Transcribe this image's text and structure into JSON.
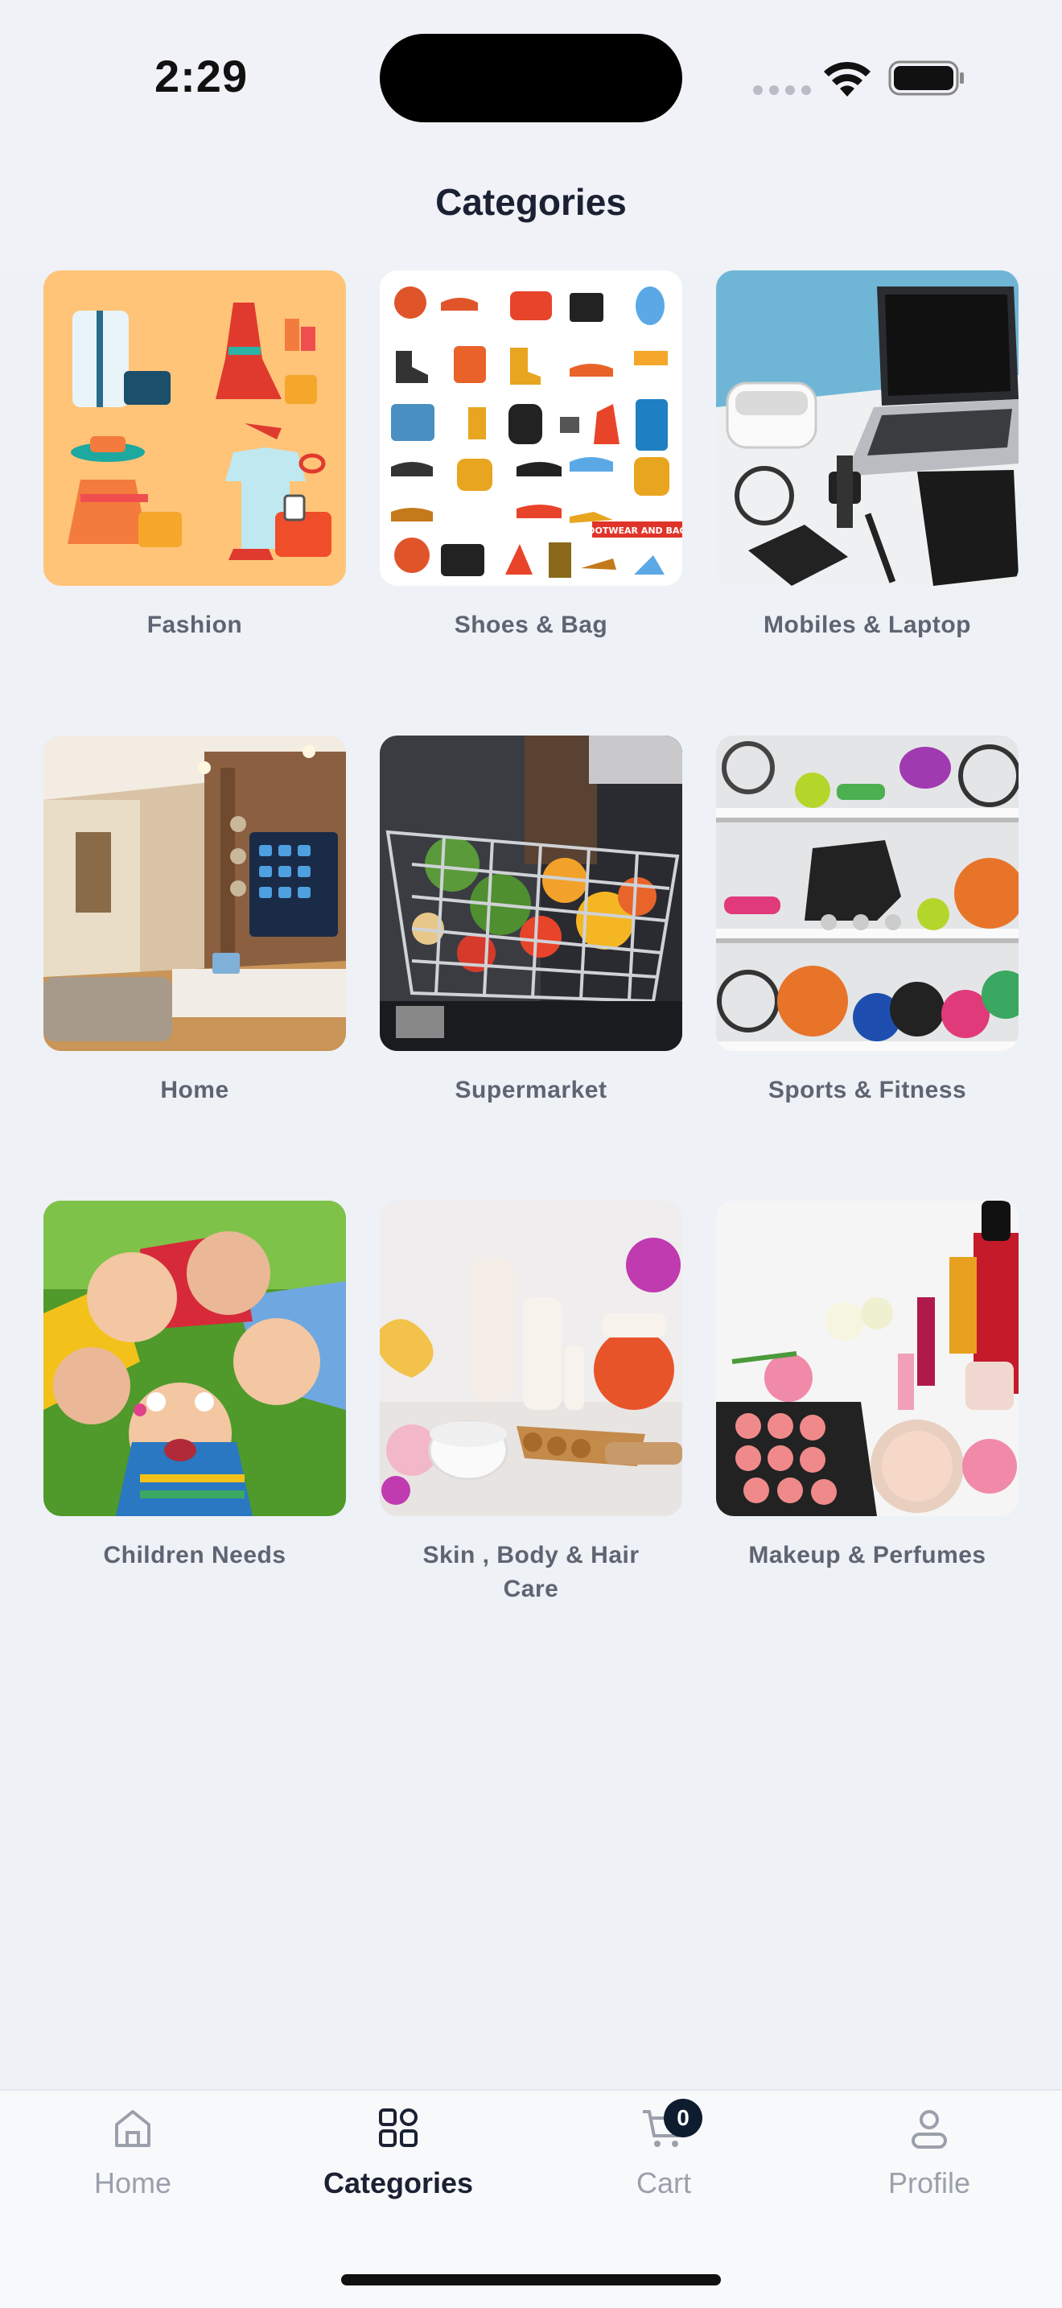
{
  "status_bar": {
    "time": "2:29"
  },
  "header": {
    "title": "Categories"
  },
  "categories": [
    {
      "label": "Fashion",
      "icon": "fashion-image"
    },
    {
      "label": "Shoes & Bag",
      "icon": "shoes-bag-image",
      "banner": "FOOTWEAR AND BAGS"
    },
    {
      "label": "Mobiles & Laptop",
      "icon": "mobiles-laptop-image"
    },
    {
      "label": "Home",
      "icon": "home-interior-image"
    },
    {
      "label": "Supermarket",
      "icon": "shopping-cart-image"
    },
    {
      "label": "Sports & Fitness",
      "icon": "sports-equipment-image"
    },
    {
      "label": "Children Needs",
      "icon": "children-image"
    },
    {
      "label": "Skin , Body & Hair Care",
      "icon": "skincare-image"
    },
    {
      "label": "Makeup & Perfumes",
      "icon": "makeup-image"
    }
  ],
  "bottom_nav": {
    "items": [
      {
        "label": "Home",
        "icon": "home-icon",
        "active": false
      },
      {
        "label": "Categories",
        "icon": "categories-icon",
        "active": true
      },
      {
        "label": "Cart",
        "icon": "cart-icon",
        "active": false,
        "badge": "0"
      },
      {
        "label": "Profile",
        "icon": "profile-icon",
        "active": false
      }
    ]
  },
  "colors": {
    "background": "#eef1f6",
    "active_text": "#1b2133",
    "inactive_text": "#9aa0ab",
    "badge": "#0e1c2f"
  }
}
